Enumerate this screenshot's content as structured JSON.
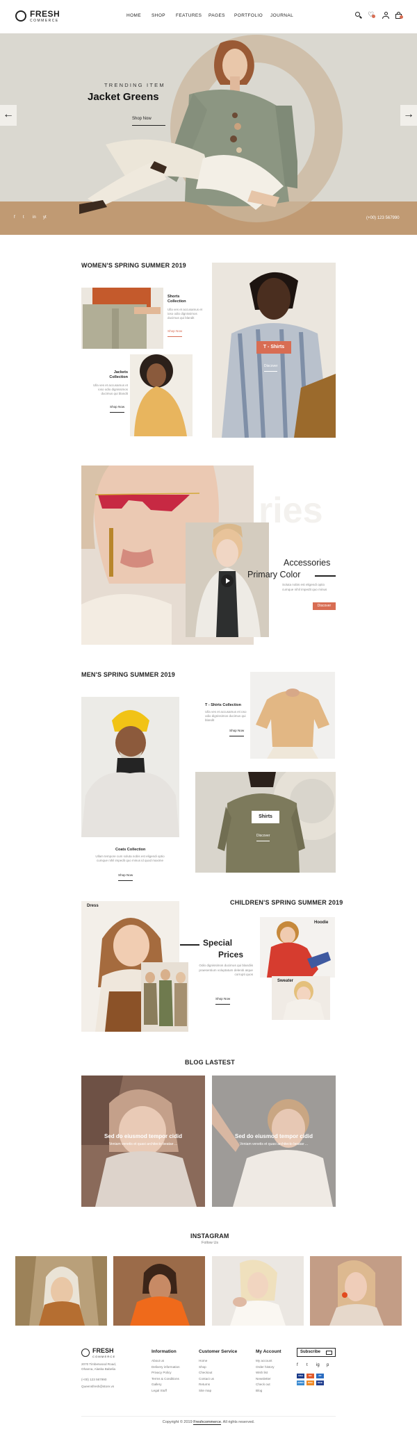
{
  "brand": {
    "name": "FRESH",
    "tag": "COMMERCE"
  },
  "nav": {
    "items": [
      "HOME",
      "SHOP",
      "FEATURES",
      "PAGES",
      "PORTFOLIO",
      "JOURNAL"
    ]
  },
  "hero": {
    "eyebrow": "TRENDING ITEM",
    "title": "Jacket Greens",
    "cta": "Shop Now",
    "phone": "(+00) 123 567990",
    "socials": [
      "f",
      "t",
      "in",
      "yt"
    ]
  },
  "women": {
    "title": "WOMEN'S SPRING SUMMER 2019",
    "shorts": {
      "title": "Shorts Collection",
      "desc": "Ulla ves et accusamus et ioso odio dignissimos ducimus qui blandit",
      "link": "Shop Now"
    },
    "jackets": {
      "title": "Jackets Collection",
      "desc": "Ulla ves et accusamus et ioso odio dignissimos ducimus qui blandit",
      "link": "Shop Now"
    },
    "tshirts": {
      "label": "T - Shirts",
      "link": "Discover"
    }
  },
  "accessories": {
    "watermark": "ries",
    "title_line1": "Accessories",
    "title_line2": "Primary Color",
    "desc": "Soluta nobis est eligendi optio cumque nihil impedit quo minus",
    "cta": "Discover"
  },
  "men": {
    "title": "MEN'S SPRING SUMMER 2019",
    "tshirts": {
      "title": "T - Shirts Collection",
      "desc": "Ulla ves et accusamus et ioso odio dignissimos ducimus qui blandit",
      "link": "Shop Now"
    },
    "coats": {
      "title": "Coats Collection",
      "desc": "Ullam tempore cum soluta nobis est eligendi optio cumque nihil impedit quo minus id quod maxime",
      "link": "Shop Now"
    },
    "shirts": {
      "label": "Shirts",
      "link": "Discover"
    }
  },
  "children": {
    "title": "CHILDREN'S SPRING SUMMER 2019",
    "dress": "Dress",
    "hoodie": "Hoodie",
    "sweater": "Sweater",
    "special_line1": "Special",
    "special_line2": "Prices",
    "desc": "Odio dignissimos ducimus qui blandiis praesentium voluptatum deleniti atque corrupti quos",
    "link": "Shop Now"
  },
  "blog": {
    "title": "BLOG LASTEST",
    "posts": [
      {
        "title": "Sed do eiusmod tempor cidid",
        "excerpt": "Veniam venetis et quasi architecto beatae ..."
      },
      {
        "title": "Sed do eiusmod tempor cidid",
        "excerpt": "Veniam venetis et quasi architecto beatae ..."
      }
    ]
  },
  "instagram": {
    "title": "INSTAGRAM",
    "subtitle": "Follow Us"
  },
  "footer": {
    "address": "2070 Timberwood Road, Ohanna, Alaska Babelia",
    "phone": "(+00) 123 567990",
    "email": "Queensfresh@store.vn",
    "information": {
      "title": "Information",
      "items": [
        "About us",
        "Delivery information",
        "Privacy Policy",
        "Terms & Conditions",
        "Gallery",
        "Legal Stuff"
      ]
    },
    "service": {
      "title": "Customer Service",
      "items": [
        "Home",
        "Shop",
        "Checkout",
        "Contact us",
        "Returns",
        "Site map"
      ]
    },
    "account": {
      "title": "My Account",
      "items": [
        "My account",
        "Order history",
        "Wish list",
        "Newsletter",
        "Check out",
        "Blog"
      ]
    },
    "subscribe": "Subscribe",
    "socials": [
      "f",
      "t",
      "ig",
      "p"
    ],
    "payments": [
      "VISA",
      "MC",
      "PP",
      "AMEX",
      "DISC",
      "MAE"
    ],
    "copyright_prefix": "Copyright © 2019",
    "copyright_brand": "Freshcommerce",
    "copyright_suffix": ". All rights reserved."
  },
  "colors": {
    "accent": "#d86d53",
    "hero_bg": "#dad8d0",
    "hero_floor": "#c09a73",
    "beige": "#d9d5cc"
  }
}
